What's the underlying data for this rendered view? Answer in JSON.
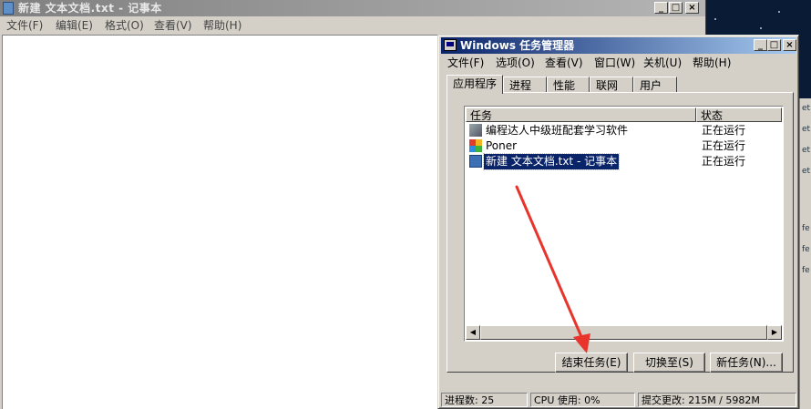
{
  "notepad": {
    "title": "新建 文本文档.txt - 记事本",
    "menu": [
      "文件(F)",
      "编辑(E)",
      "格式(O)",
      "查看(V)",
      "帮助(H)"
    ],
    "min": "_",
    "max": "□",
    "close": "×"
  },
  "taskmanager": {
    "title": "Windows 任务管理器",
    "menu": [
      "文件(F)",
      "选项(O)",
      "查看(V)",
      "窗口(W)",
      "关机(U)",
      "帮助(H)"
    ],
    "min": "_",
    "max": "□",
    "close": "×",
    "tabs": [
      "应用程序",
      "进程",
      "性能",
      "联网",
      "用户"
    ],
    "active_tab": "应用程序",
    "columns": [
      "任务",
      "状态"
    ],
    "tasks": [
      {
        "name": "编程达人中级班配套学习软件",
        "status": "正在运行",
        "icon": "program-icon"
      },
      {
        "name": "Poner",
        "status": "正在运行",
        "icon": "colored-tiles-icon"
      },
      {
        "name": "新建 文本文档.txt - 记事本",
        "status": "正在运行",
        "icon": "notepad-icon",
        "selected": true
      }
    ],
    "buttons": {
      "end_task": "结束任务(E)",
      "switch_to": "切换至(S)",
      "new_task": "新任务(N)..."
    },
    "statusbar": {
      "processes": "进程数: 25",
      "cpu": "CPU 使用: 0%",
      "commit": "提交更改: 215M / 5982M"
    }
  },
  "annotation": {
    "color": "#e8342b"
  },
  "background_window": {
    "fragments": [
      "et",
      "et",
      "et",
      "et",
      "fe",
      "fe",
      "fe",
      "fe",
      "fe"
    ]
  }
}
